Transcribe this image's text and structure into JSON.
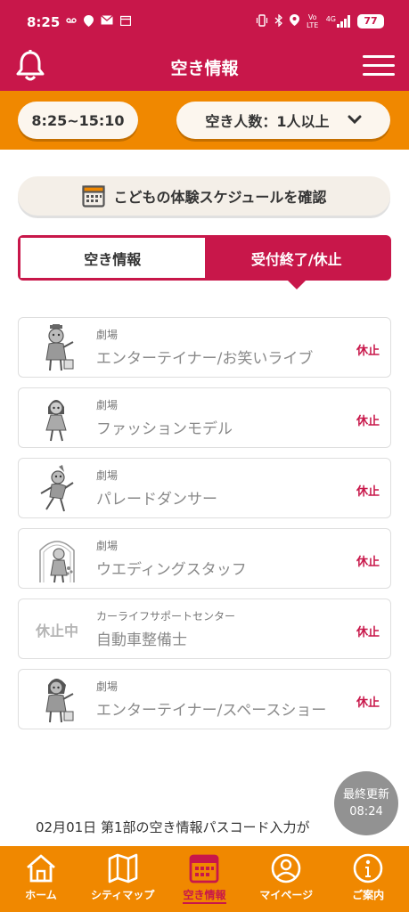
{
  "status_bar": {
    "time": "8:25",
    "left_icons": [
      "voicemail-icon",
      "location-icon",
      "mail-icon",
      "calendar-icon"
    ],
    "right_icons": [
      "vibrate-icon",
      "bluetooth-icon",
      "location-icon",
      "volte-icon",
      "signal-4g-icon"
    ],
    "volte_text": "Vo LTE",
    "network_text": "4G",
    "battery": "77"
  },
  "header": {
    "title": "空き情報",
    "left_icon": "bell-icon",
    "right_icon": "menu-icon"
  },
  "filters": {
    "time_range": "8:25~15:10",
    "capacity": "空き人数：1人以上",
    "capacity_icon": "chevron-down-icon"
  },
  "schedule_button": {
    "label": "こどもの体験スケジュールを確認",
    "icon": "calendar-icon"
  },
  "tabs": [
    {
      "label": "空き情報",
      "active": false
    },
    {
      "label": "受付終了/休止",
      "active": true
    }
  ],
  "items": [
    {
      "category": "劇場",
      "name": "エンターテイナー/お笑いライブ",
      "status": "休止",
      "thumb": "entertainer-figure"
    },
    {
      "category": "劇場",
      "name": "ファッションモデル",
      "status": "休止",
      "thumb": "model-figure"
    },
    {
      "category": "劇場",
      "name": "パレードダンサー",
      "status": "休止",
      "thumb": "dancer-figure"
    },
    {
      "category": "劇場",
      "name": "ウエディングスタッフ",
      "status": "休止",
      "thumb": "wedding-figure"
    },
    {
      "category": "カーライフサポートセンター",
      "name": "自動車整備士",
      "status": "休止",
      "thumb_text": "休止中"
    },
    {
      "category": "劇場",
      "name": "エンターテイナー/スペースショー",
      "status": "休止",
      "thumb": "entertainer-figure"
    }
  ],
  "notice": "02月01日 第1部の空き情報パスコード入力が",
  "update_badge": {
    "label": "最終更新",
    "time": "08:24"
  },
  "bottom_nav": [
    {
      "label": "ホーム",
      "icon": "home-icon"
    },
    {
      "label": "シティマップ",
      "icon": "map-icon"
    },
    {
      "label": "空き情報",
      "icon": "calendar-icon",
      "active": true
    },
    {
      "label": "マイページ",
      "icon": "user-icon"
    },
    {
      "label": "ご案内",
      "icon": "info-icon"
    }
  ],
  "colors": {
    "primary": "#c8174a",
    "accent": "#f08800",
    "muted_text": "#8a8a8a"
  }
}
